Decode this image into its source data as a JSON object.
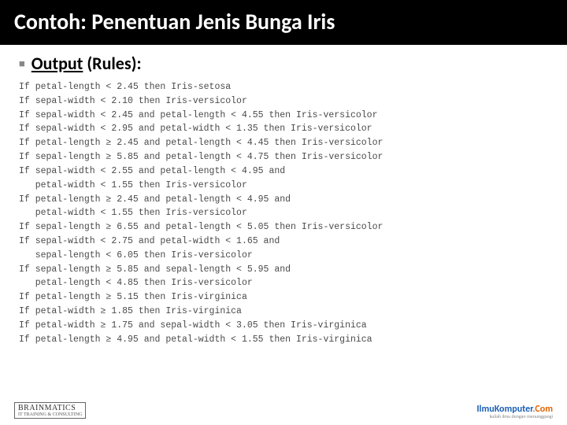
{
  "title": "Contoh: Penentuan Jenis Bunga Iris",
  "subtitle_prefix": "Output",
  "subtitle_suffix": " (Rules):",
  "rules": "If petal-length < 2.45 then Iris-setosa\nIf sepal-width < 2.10 then Iris-versicolor\nIf sepal-width < 2.45 and petal-length < 4.55 then Iris-versicolor\nIf sepal-width < 2.95 and petal-width < 1.35 then Iris-versicolor\nIf petal-length ≥ 2.45 and petal-length < 4.45 then Iris-versicolor\nIf sepal-length ≥ 5.85 and petal-length < 4.75 then Iris-versicolor\nIf sepal-width < 2.55 and petal-length < 4.95 and\n   petal-width < 1.55 then Iris-versicolor\nIf petal-length ≥ 2.45 and petal-length < 4.95 and\n   petal-width < 1.55 then Iris-versicolor\nIf sepal-length ≥ 6.55 and petal-length < 5.05 then Iris-versicolor\nIf sepal-width < 2.75 and petal-width < 1.65 and\n   sepal-length < 6.05 then Iris-versicolor\nIf sepal-length ≥ 5.85 and sepal-length < 5.95 and\n   petal-length < 4.85 then Iris-versicolor\nIf petal-length ≥ 5.15 then Iris-virginica\nIf petal-width ≥ 1.85 then Iris-virginica\nIf petal-width ≥ 1.75 and sepal-width < 3.05 then Iris-virginica\nIf petal-length ≥ 4.95 and petal-width < 1.55 then Iris-virginica",
  "footer_left": "BRAINMATICS",
  "footer_left_tag": "IT TRAINING & CONSULTING",
  "footer_right_brand_1": "Ilmu",
  "footer_right_brand_2": "Komputer",
  "footer_right_brand_3": ".",
  "footer_right_brand_4": "Com",
  "footer_right_tag": "kuliah ilmu dengan menunggangi"
}
